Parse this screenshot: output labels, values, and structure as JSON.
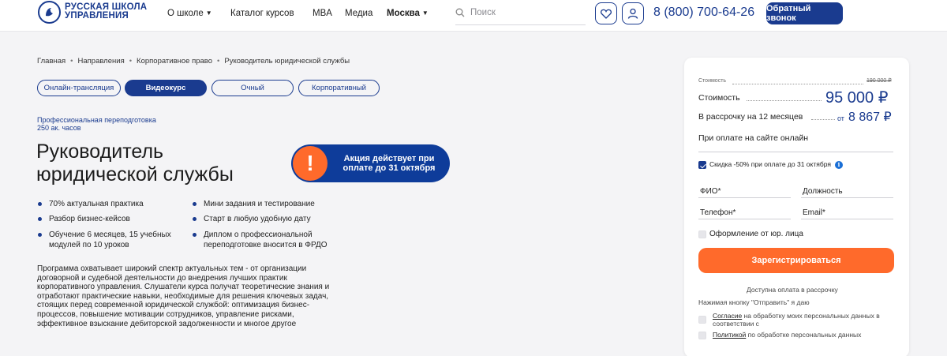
{
  "header": {
    "logo_line1": "РУССКАЯ ШКОЛА",
    "logo_line2": "УПРАВЛЕНИЯ",
    "nav": [
      {
        "label": "О школе",
        "dropdown": true
      },
      {
        "label": "Каталог курсов",
        "dropdown": false
      },
      {
        "label": "MBA",
        "dropdown": false
      },
      {
        "label": "Медиа",
        "dropdown": false
      },
      {
        "label": "Москва",
        "dropdown": true
      }
    ],
    "search_placeholder": "Поиск",
    "phone": "8 (800) 700-64-26",
    "callback_label": "Обратный звонок"
  },
  "breadcrumbs": [
    "Главная",
    "Направления",
    "Корпоративное право",
    "Руководитель юридической службы"
  ],
  "format_tabs": [
    {
      "label": "Онлайн-трансляция",
      "active": false
    },
    {
      "label": "Видеокурс",
      "active": true
    },
    {
      "label": "Очный",
      "active": false
    },
    {
      "label": "Корпоративный",
      "active": false
    }
  ],
  "program": {
    "type": "Профессиональная переподготовка",
    "hours": "250 ак. часов",
    "title": "Руководитель юридической службы",
    "promo_icon": "!",
    "promo_text": "Акция действует при оплате до 31 октября",
    "features_left": [
      "70% актуальная практика",
      "Разбор бизнес-кейсов",
      "Обучение 6 месяцев, 15 учебных модулей по 10 уроков"
    ],
    "features_right": [
      "Мини задания и тестирование",
      "Старт в любую удобную дату",
      "Диплом о профессиональной переподготовке вносится в ФРДО"
    ],
    "description": "Программа охватывает широкий спектр актуальных тем - от организации договорной и судебной деятельности до внедрения лучших практик корпоративного управления. Слушатели курса получат теоретические знания и отработают практические навыки, необходимые для решения ключевых задач, стоящих перед современной юридической службой: оптимизация бизнес-процессов, повышение мотивации сотрудников, управление рисками, эффективное взыскание дебиторской задолженности и многое другое"
  },
  "form": {
    "old_price_label": "Стоимость",
    "old_price": "190 000 ₽",
    "price_label": "Стоимость",
    "price": "95 000 ₽",
    "installment_label": "В рассрочку на 12 месяцев",
    "installment_prefix": "от",
    "installment_price": "8 867 ₽",
    "online_pay_label": "При оплате на сайте онлайн",
    "discount_label": "Скидка -50% при оплате до 31 октября",
    "discount_checked": true,
    "fields": [
      "ФИО*",
      "Должность",
      "Телефон*",
      "Email*"
    ],
    "legal_entity_label": "Оформление от юр. лица",
    "register_label": "Зарегистрироваться",
    "installment_note": "Доступна оплата в рассрочку",
    "send_note": "Нажимая кнопку \"Отправить\" я даю",
    "consent1_link": "Согласие",
    "consent1_text_a": " на обработку моих персональных данных в",
    "consent1_text_b": "соответствии с",
    "consent2_link": "Политикой",
    "consent2_text": " по обработке персональных данных"
  },
  "colors": {
    "brand": "#1a3b8f",
    "accent": "#ff6a2b",
    "promo_bg": "#0e3c9a"
  }
}
